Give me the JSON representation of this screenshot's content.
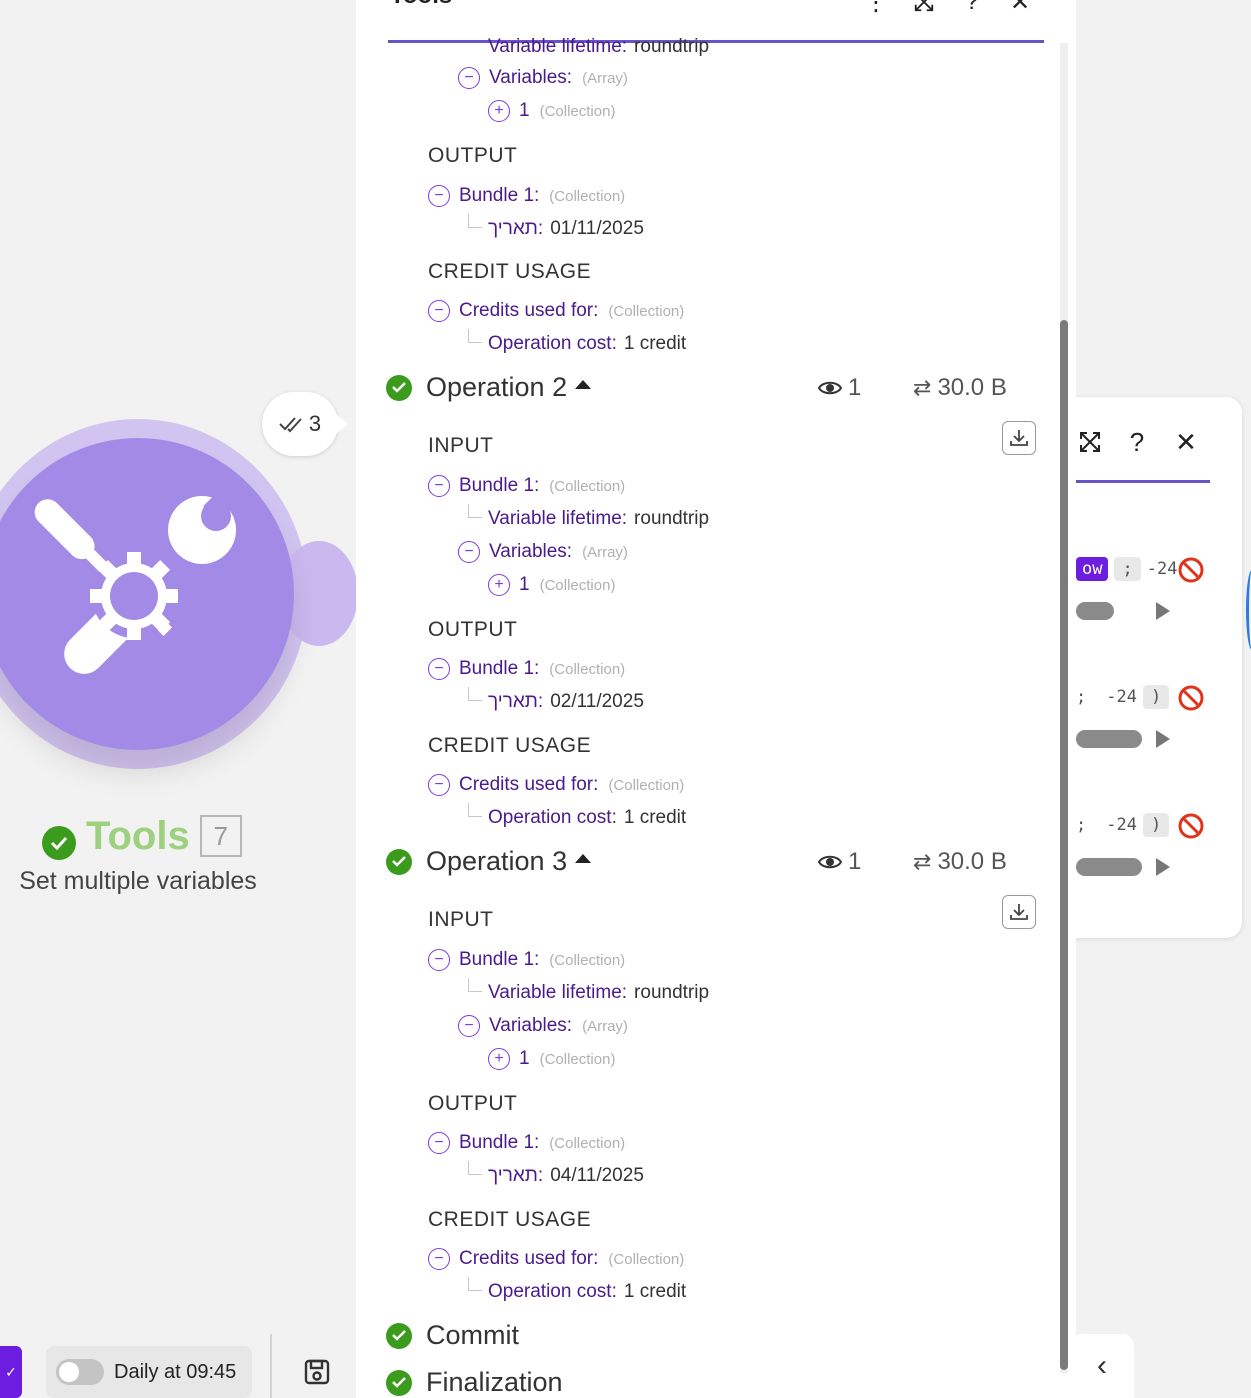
{
  "canvas": {
    "module": {
      "ops_count": "3",
      "name": "Tools",
      "id": "7",
      "subtitle": "Set multiple variables",
      "color": "#a48ae7"
    },
    "bottom_bar": {
      "schedule_label": "Daily at 09:45",
      "schedule_enabled": false
    },
    "right_panel": {
      "rows": [
        {
          "chip": "ow",
          "sep": ";",
          "value": "-24"
        },
        {
          "sep": ";",
          "value": "-24",
          "close": ")"
        },
        {
          "sep": ";",
          "value": "-24",
          "close": ")"
        }
      ]
    }
  },
  "panel": {
    "title": "Tools",
    "accent": "#6a52c7",
    "top_fragment": {
      "lifetime_key": "Variable lifetime:",
      "lifetime_val": "roundtrip",
      "variables_key": "Variables:",
      "variables_type": "(Array)",
      "item_key": "1",
      "item_type": "(Collection)",
      "output_label": "OUTPUT",
      "bundle_key": "Bundle 1:",
      "bundle_type": "(Collection)",
      "date_key": "תאריך:",
      "date_val": "01/11/2025",
      "credit_label": "CREDIT USAGE",
      "credits_key": "Credits used for:",
      "credits_type": "(Collection)",
      "cost_key": "Operation cost:",
      "cost_val": "1 credit"
    },
    "operations": [
      {
        "title": "Operation 2",
        "views": "1",
        "size": "30.0 B",
        "input_label": "INPUT",
        "bundle_key": "Bundle 1:",
        "bundle_type": "(Collection)",
        "lifetime_key": "Variable lifetime:",
        "lifetime_val": "roundtrip",
        "variables_key": "Variables:",
        "variables_type": "(Array)",
        "item_key": "1",
        "item_type": "(Collection)",
        "output_label": "OUTPUT",
        "out_bundle_key": "Bundle 1:",
        "out_bundle_type": "(Collection)",
        "date_key": "תאריך:",
        "date_val": "02/11/2025",
        "credit_label": "CREDIT USAGE",
        "credits_key": "Credits used for:",
        "credits_type": "(Collection)",
        "cost_key": "Operation cost:",
        "cost_val": "1 credit"
      },
      {
        "title": "Operation 3",
        "views": "1",
        "size": "30.0 B",
        "input_label": "INPUT",
        "bundle_key": "Bundle 1:",
        "bundle_type": "(Collection)",
        "lifetime_key": "Variable lifetime:",
        "lifetime_val": "roundtrip",
        "variables_key": "Variables:",
        "variables_type": "(Array)",
        "item_key": "1",
        "item_type": "(Collection)",
        "output_label": "OUTPUT",
        "out_bundle_key": "Bundle 1:",
        "out_bundle_type": "(Collection)",
        "date_key": "תאריך:",
        "date_val": "04/11/2025",
        "credit_label": "CREDIT USAGE",
        "credits_key": "Credits used for:",
        "credits_type": "(Collection)",
        "cost_key": "Operation cost:",
        "cost_val": "1 credit"
      }
    ],
    "commit_label": "Commit",
    "finalization_label": "Finalization"
  },
  "icons": [
    "tools-icon",
    "check-icon",
    "eye-icon",
    "transfer-icon",
    "download-icon",
    "minus-circle-icon",
    "plus-circle-icon",
    "more-icon",
    "expand-icon",
    "help-icon",
    "close-icon",
    "ban-icon",
    "save-icon",
    "chevron-left-icon"
  ],
  "colors": {
    "success": "#3a9b1c",
    "key_text": "#4a1a8c",
    "toggle_icon": "#7c3ae0",
    "danger": "#e0321c"
  }
}
